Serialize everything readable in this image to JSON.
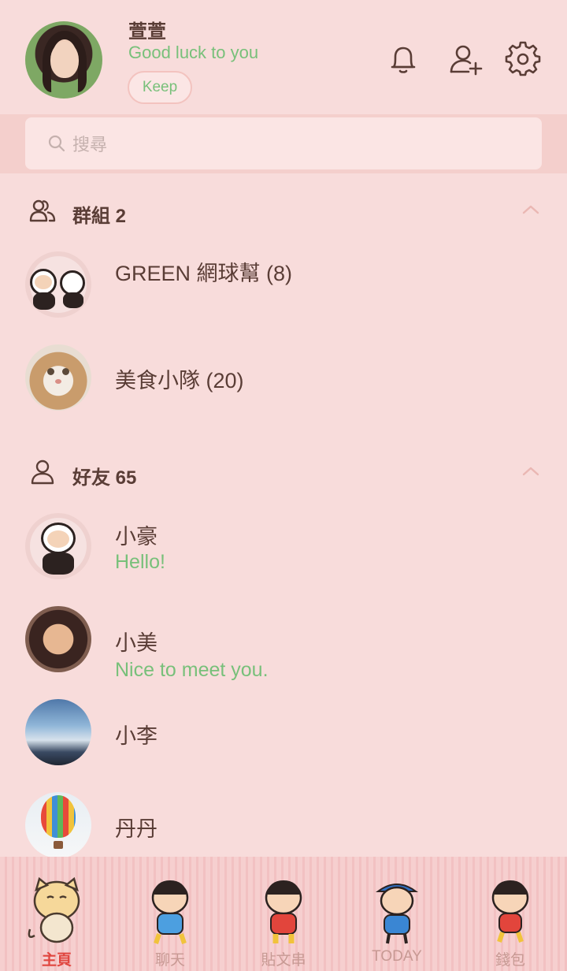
{
  "header": {
    "name": "萱萱",
    "status": "Good luck to you",
    "keep_label": "Keep"
  },
  "search": {
    "placeholder": "搜尋"
  },
  "groups": {
    "label": "群組 2",
    "items": [
      {
        "name": "GREEN 網球幫 (8)"
      },
      {
        "name": "美食小隊 (20)"
      }
    ]
  },
  "friends": {
    "label": "好友 65",
    "items": [
      {
        "name": "小豪",
        "message": "Hello!"
      },
      {
        "name": "小美",
        "message": "Nice to meet you."
      },
      {
        "name": "小李"
      },
      {
        "name": "丹丹"
      }
    ]
  },
  "tabs": [
    {
      "label": "主頁",
      "active": true
    },
    {
      "label": "聊天"
    },
    {
      "label": "貼文串"
    },
    {
      "label": "TODAY"
    },
    {
      "label": "錢包"
    }
  ],
  "colors": {
    "background": "#f8dcdb",
    "accent_green": "#78c07a",
    "text_brown": "#5a3d36",
    "active_tab": "#e0463f"
  },
  "icons": {
    "header": [
      "bell-icon",
      "add-friend-icon",
      "gear-icon"
    ],
    "search": "search-icon",
    "groups": "group-icon",
    "friends": "person-icon"
  }
}
